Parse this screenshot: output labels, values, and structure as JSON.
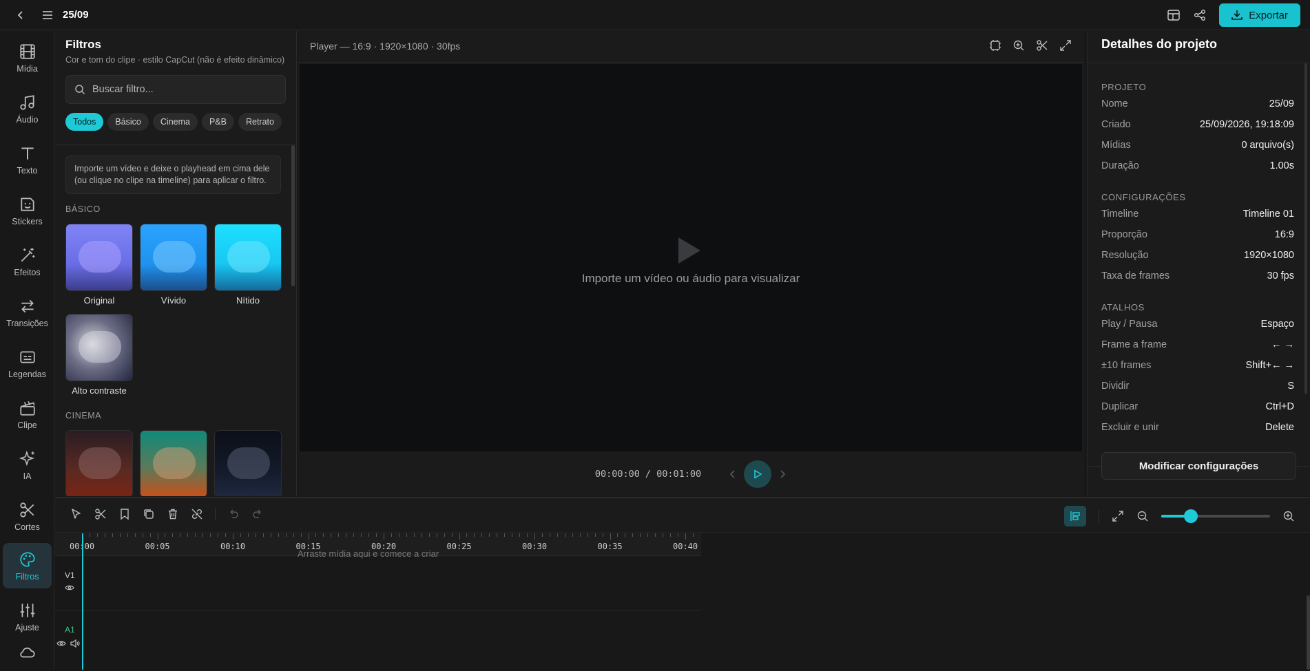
{
  "header": {
    "project_title": "25/09",
    "export_label": "Exportar"
  },
  "sidebar": {
    "items": [
      {
        "label": "Mídia",
        "icon": "film-icon"
      },
      {
        "label": "Áudio",
        "icon": "music-icon"
      },
      {
        "label": "Texto",
        "icon": "text-icon"
      },
      {
        "label": "Stickers",
        "icon": "sticker-icon"
      },
      {
        "label": "Efeitos",
        "icon": "wand-icon"
      },
      {
        "label": "Transições",
        "icon": "transition-icon"
      },
      {
        "label": "Legendas",
        "icon": "captions-icon"
      },
      {
        "label": "Clipe",
        "icon": "clapper-icon"
      },
      {
        "label": "IA",
        "icon": "sparkles-icon"
      },
      {
        "label": "Cortes",
        "icon": "scissors-icon"
      },
      {
        "label": "Filtros",
        "icon": "palette-icon",
        "active": true
      },
      {
        "label": "Ajuste",
        "icon": "sliders-icon"
      },
      {
        "label": "",
        "icon": "cloud-icon"
      }
    ]
  },
  "filters_panel": {
    "title": "Filtros",
    "subtitle": "Cor e tom do clipe · estilo CapCut (não é efeito dinâmico)",
    "search_placeholder": "Buscar filtro...",
    "chips": [
      "Todos",
      "Básico",
      "Cinema",
      "P&B",
      "Retrato"
    ],
    "active_chip": "Todos",
    "hint": "Importe um vídeo e deixe o playhead em cima dele (ou clique no clipe na timeline) para aplicar o filtro.",
    "sections": [
      {
        "label": "BÁSICO",
        "filters": [
          "Original",
          "Vívido",
          "Nítido",
          "Alto contraste"
        ]
      },
      {
        "label": "CINEMA",
        "filters": [
          "",
          "",
          ""
        ]
      }
    ]
  },
  "player": {
    "title": "Player — 16:9 · 1920×1080 · 30fps",
    "empty_message": "Importe um vídeo ou áudio para visualizar",
    "current_time": "00:00:00",
    "total_time": "/ 00:01:00"
  },
  "details": {
    "title": "Detalhes do projeto",
    "sections": [
      {
        "label": "PROJETO",
        "rows": [
          {
            "k": "Nome",
            "v": "25/09"
          },
          {
            "k": "Criado",
            "v": "25/09/2026, 19:18:09"
          },
          {
            "k": "Mídias",
            "v": "0 arquivo(s)"
          },
          {
            "k": "Duração",
            "v": "1.00s"
          }
        ]
      },
      {
        "label": "CONFIGURAÇÕES",
        "rows": [
          {
            "k": "Timeline",
            "v": "Timeline 01"
          },
          {
            "k": "Proporção",
            "v": "16:9"
          },
          {
            "k": "Resolução",
            "v": "1920×1080"
          },
          {
            "k": "Taxa de frames",
            "v": "30 fps"
          }
        ]
      },
      {
        "label": "ATALHOS",
        "rows": [
          {
            "k": "Play / Pausa",
            "v": "Espaço"
          },
          {
            "k": "Frame a frame",
            "v": "← →"
          },
          {
            "k": "±10 frames",
            "v": "Shift+← →"
          },
          {
            "k": "Dividir",
            "v": "S"
          },
          {
            "k": "Duplicar",
            "v": "Ctrl+D"
          },
          {
            "k": "Excluir e unir",
            "v": "Delete"
          }
        ]
      }
    ],
    "modify_label": "Modificar configurações"
  },
  "timeline": {
    "ruler_labels": [
      "00:00",
      "00:05",
      "00:10",
      "00:15",
      "00:20",
      "00:25",
      "00:30",
      "00:35",
      "00:40"
    ],
    "drop_hint": "Arraste mídia aqui e comece a criar",
    "tracks": [
      {
        "label": "V1"
      },
      {
        "label": "A1"
      }
    ],
    "zoom_level": 0.27
  },
  "colors": {
    "accent": "#1ecad6",
    "background": "#181818"
  }
}
